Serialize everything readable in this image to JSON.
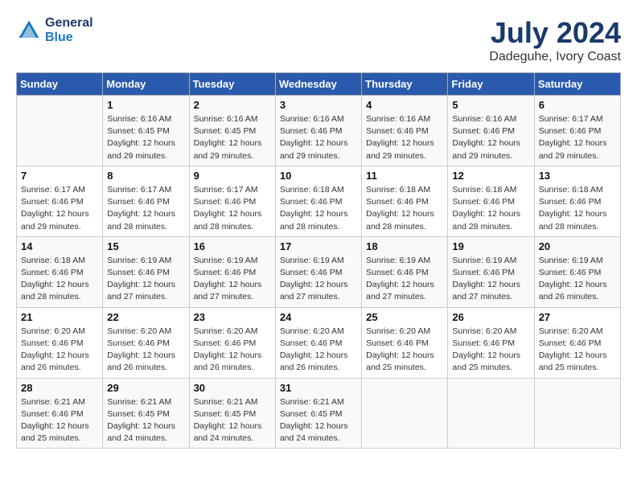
{
  "logo": {
    "line1": "General",
    "line2": "Blue"
  },
  "title": "July 2024",
  "subtitle": "Dadeguhe, Ivory Coast",
  "headers": [
    "Sunday",
    "Monday",
    "Tuesday",
    "Wednesday",
    "Thursday",
    "Friday",
    "Saturday"
  ],
  "weeks": [
    [
      {
        "day": "",
        "info": ""
      },
      {
        "day": "1",
        "info": "Sunrise: 6:16 AM\nSunset: 6:45 PM\nDaylight: 12 hours\nand 29 minutes."
      },
      {
        "day": "2",
        "info": "Sunrise: 6:16 AM\nSunset: 6:45 PM\nDaylight: 12 hours\nand 29 minutes."
      },
      {
        "day": "3",
        "info": "Sunrise: 6:16 AM\nSunset: 6:46 PM\nDaylight: 12 hours\nand 29 minutes."
      },
      {
        "day": "4",
        "info": "Sunrise: 6:16 AM\nSunset: 6:46 PM\nDaylight: 12 hours\nand 29 minutes."
      },
      {
        "day": "5",
        "info": "Sunrise: 6:16 AM\nSunset: 6:46 PM\nDaylight: 12 hours\nand 29 minutes."
      },
      {
        "day": "6",
        "info": "Sunrise: 6:17 AM\nSunset: 6:46 PM\nDaylight: 12 hours\nand 29 minutes."
      }
    ],
    [
      {
        "day": "7",
        "info": "Sunrise: 6:17 AM\nSunset: 6:46 PM\nDaylight: 12 hours\nand 29 minutes."
      },
      {
        "day": "8",
        "info": "Sunrise: 6:17 AM\nSunset: 6:46 PM\nDaylight: 12 hours\nand 28 minutes."
      },
      {
        "day": "9",
        "info": "Sunrise: 6:17 AM\nSunset: 6:46 PM\nDaylight: 12 hours\nand 28 minutes."
      },
      {
        "day": "10",
        "info": "Sunrise: 6:18 AM\nSunset: 6:46 PM\nDaylight: 12 hours\nand 28 minutes."
      },
      {
        "day": "11",
        "info": "Sunrise: 6:18 AM\nSunset: 6:46 PM\nDaylight: 12 hours\nand 28 minutes."
      },
      {
        "day": "12",
        "info": "Sunrise: 6:18 AM\nSunset: 6:46 PM\nDaylight: 12 hours\nand 28 minutes."
      },
      {
        "day": "13",
        "info": "Sunrise: 6:18 AM\nSunset: 6:46 PM\nDaylight: 12 hours\nand 28 minutes."
      }
    ],
    [
      {
        "day": "14",
        "info": "Sunrise: 6:18 AM\nSunset: 6:46 PM\nDaylight: 12 hours\nand 28 minutes."
      },
      {
        "day": "15",
        "info": "Sunrise: 6:19 AM\nSunset: 6:46 PM\nDaylight: 12 hours\nand 27 minutes."
      },
      {
        "day": "16",
        "info": "Sunrise: 6:19 AM\nSunset: 6:46 PM\nDaylight: 12 hours\nand 27 minutes."
      },
      {
        "day": "17",
        "info": "Sunrise: 6:19 AM\nSunset: 6:46 PM\nDaylight: 12 hours\nand 27 minutes."
      },
      {
        "day": "18",
        "info": "Sunrise: 6:19 AM\nSunset: 6:46 PM\nDaylight: 12 hours\nand 27 minutes."
      },
      {
        "day": "19",
        "info": "Sunrise: 6:19 AM\nSunset: 6:46 PM\nDaylight: 12 hours\nand 27 minutes."
      },
      {
        "day": "20",
        "info": "Sunrise: 6:19 AM\nSunset: 6:46 PM\nDaylight: 12 hours\nand 26 minutes."
      }
    ],
    [
      {
        "day": "21",
        "info": "Sunrise: 6:20 AM\nSunset: 6:46 PM\nDaylight: 12 hours\nand 26 minutes."
      },
      {
        "day": "22",
        "info": "Sunrise: 6:20 AM\nSunset: 6:46 PM\nDaylight: 12 hours\nand 26 minutes."
      },
      {
        "day": "23",
        "info": "Sunrise: 6:20 AM\nSunset: 6:46 PM\nDaylight: 12 hours\nand 26 minutes."
      },
      {
        "day": "24",
        "info": "Sunrise: 6:20 AM\nSunset: 6:46 PM\nDaylight: 12 hours\nand 26 minutes."
      },
      {
        "day": "25",
        "info": "Sunrise: 6:20 AM\nSunset: 6:46 PM\nDaylight: 12 hours\nand 25 minutes."
      },
      {
        "day": "26",
        "info": "Sunrise: 6:20 AM\nSunset: 6:46 PM\nDaylight: 12 hours\nand 25 minutes."
      },
      {
        "day": "27",
        "info": "Sunrise: 6:20 AM\nSunset: 6:46 PM\nDaylight: 12 hours\nand 25 minutes."
      }
    ],
    [
      {
        "day": "28",
        "info": "Sunrise: 6:21 AM\nSunset: 6:46 PM\nDaylight: 12 hours\nand 25 minutes."
      },
      {
        "day": "29",
        "info": "Sunrise: 6:21 AM\nSunset: 6:45 PM\nDaylight: 12 hours\nand 24 minutes."
      },
      {
        "day": "30",
        "info": "Sunrise: 6:21 AM\nSunset: 6:45 PM\nDaylight: 12 hours\nand 24 minutes."
      },
      {
        "day": "31",
        "info": "Sunrise: 6:21 AM\nSunset: 6:45 PM\nDaylight: 12 hours\nand 24 minutes."
      },
      {
        "day": "",
        "info": ""
      },
      {
        "day": "",
        "info": ""
      },
      {
        "day": "",
        "info": ""
      }
    ]
  ]
}
